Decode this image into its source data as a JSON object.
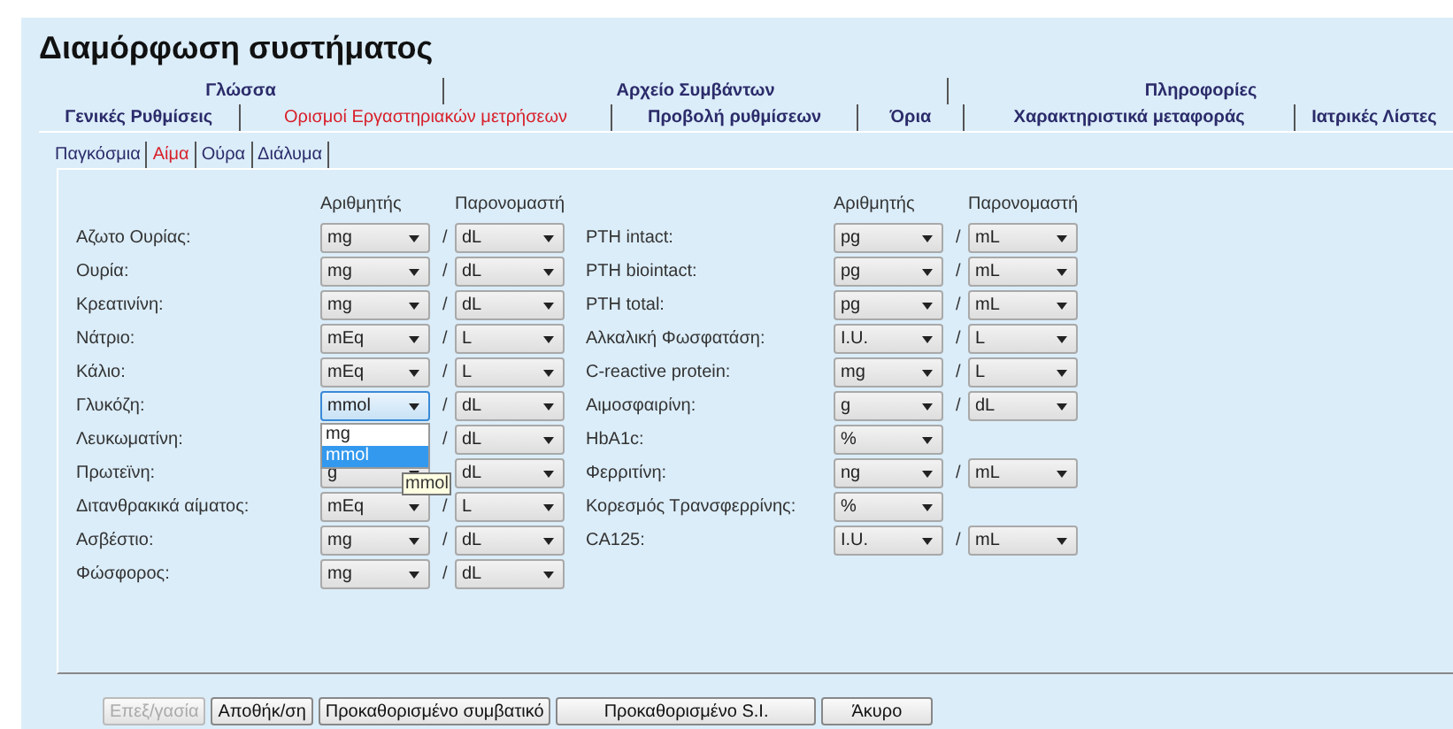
{
  "window": {
    "title": "Διαμόρφωση συστήματος"
  },
  "tab_rows": [
    [
      {
        "label": "Γλώσσα",
        "selected": false
      },
      {
        "label": "Αρχείο Συμβάντων",
        "selected": false
      },
      {
        "label": "Πληροφορίες",
        "selected": false
      }
    ],
    [
      {
        "label": "Γενικές Ρυθμίσεις",
        "selected": false
      },
      {
        "label": "Ορισμοί Εργαστηριακών μετρήσεων",
        "selected": true
      },
      {
        "label": "Προβολή ρυθμίσεων",
        "selected": false
      },
      {
        "label": "Όρια",
        "selected": false
      },
      {
        "label": "Χαρακτηριστικά μεταφοράς",
        "selected": false
      },
      {
        "label": "Ιατρικές Λίστες",
        "selected": false
      }
    ]
  ],
  "subtabs": [
    {
      "label": "Παγκόσμια",
      "selected": false
    },
    {
      "label": "Αίμα",
      "selected": true
    },
    {
      "label": "Ούρα",
      "selected": false
    },
    {
      "label": "Διάλυμα",
      "selected": false
    }
  ],
  "columns": [
    {
      "numerator_header": "Αριθμητής",
      "denominator_header": "Παρονομαστή",
      "rows": [
        {
          "label": "Αζωτο Ουρίας:",
          "numerator": "mg",
          "separator": "/",
          "denominator": "dL",
          "focused": false
        },
        {
          "label": "Ουρία:",
          "numerator": "mg",
          "separator": "/",
          "denominator": "dL",
          "focused": false
        },
        {
          "label": "Κρεατινίνη:",
          "numerator": "mg",
          "separator": "/",
          "denominator": "dL",
          "focused": false
        },
        {
          "label": "Νάτριο:",
          "numerator": "mEq",
          "separator": "/",
          "denominator": "L",
          "focused": false
        },
        {
          "label": "Κάλιο:",
          "numerator": "mEq",
          "separator": "/",
          "denominator": "L",
          "focused": false
        },
        {
          "label": "Γλυκόζη:",
          "numerator": "mmol",
          "separator": "/",
          "denominator": "dL",
          "focused": true,
          "dropdown": {
            "options": [
              {
                "label": "mg",
                "selected": false
              },
              {
                "label": "mmol",
                "selected": true
              }
            ],
            "tooltip": "mmol"
          }
        },
        {
          "label": "Λευκωματίνη:",
          "separator": "/",
          "denominator": "dL"
        },
        {
          "label": "Πρωτεϊνη:",
          "numerator": "g",
          "denominator": "dL",
          "focused": false
        },
        {
          "label": "Διτανθρακικά αίματος:",
          "numerator": "mEq",
          "separator": "/",
          "denominator": "L",
          "focused": false
        },
        {
          "label": "Ασβέστιο:",
          "numerator": "mg",
          "separator": "/",
          "denominator": "dL",
          "focused": false
        },
        {
          "label": "Φώσφορος:",
          "numerator": "mg",
          "separator": "/",
          "denominator": "dL",
          "focused": false
        }
      ]
    },
    {
      "numerator_header": "Αριθμητής",
      "denominator_header": "Παρονομαστή",
      "rows": [
        {
          "label": "PTH intact:",
          "numerator": "pg",
          "separator": "/",
          "denominator": "mL",
          "focused": false
        },
        {
          "label": "PTH biointact:",
          "numerator": "pg",
          "separator": "/",
          "denominator": "mL",
          "focused": false
        },
        {
          "label": "PTH total:",
          "numerator": "pg",
          "separator": "/",
          "denominator": "mL",
          "focused": false
        },
        {
          "label": "Αλκαλική Φωσφατάση:",
          "numerator": "I.U.",
          "separator": "/",
          "denominator": "L",
          "focused": false
        },
        {
          "label": "C-reactive protein:",
          "numerator": "mg",
          "separator": "/",
          "denominator": "L",
          "focused": false
        },
        {
          "label": "Αιμοσφαιρίνη:",
          "numerator": "g",
          "separator": "/",
          "denominator": "dL",
          "focused": false
        },
        {
          "label": "HbA1c:",
          "numerator": "%",
          "focused": false
        },
        {
          "label": "Φερριτίνη:",
          "numerator": "ng",
          "separator": "/",
          "denominator": "mL",
          "focused": false
        },
        {
          "label": "Κορεσμός Τρανσφερρίνης:",
          "numerator": "%",
          "focused": false
        },
        {
          "label": "CA125:",
          "numerator": "I.U.",
          "separator": "/",
          "denominator": "mL",
          "focused": false
        }
      ]
    }
  ],
  "buttons": [
    {
      "label": "Επεξ/γασία",
      "disabled": true
    },
    {
      "label": "Αποθήκ/ση",
      "disabled": false
    },
    {
      "label": "Προκαθορισμένο συμβατικό",
      "disabled": false
    },
    {
      "label": "Προκαθορισμένο S.I.",
      "disabled": false
    },
    {
      "label": "Άκυρο",
      "disabled": false
    }
  ]
}
